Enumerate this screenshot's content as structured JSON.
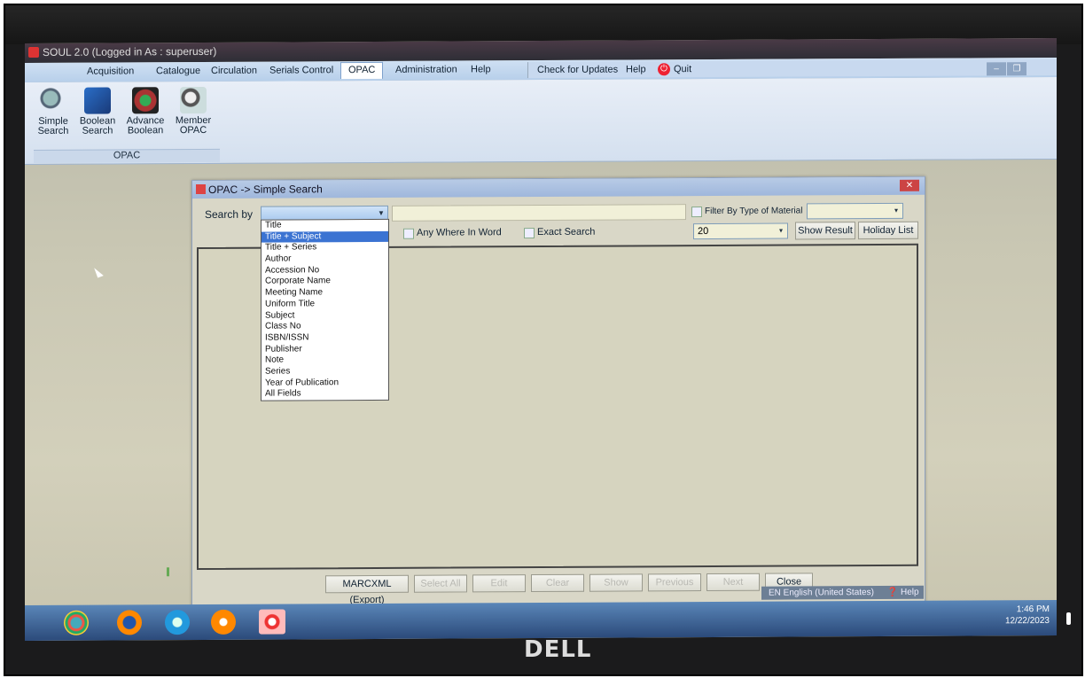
{
  "window": {
    "title": "SOUL 2.0  (Logged in As : superuser)"
  },
  "menu": {
    "items": [
      "Acquisition",
      "Catalogue",
      "Circulation",
      "Serials Control",
      "OPAC",
      "Administration",
      "Help"
    ],
    "right": [
      "Check for Updates",
      "Help",
      "Quit"
    ],
    "active": "OPAC"
  },
  "ribbon": {
    "buttons": [
      {
        "line1": "Simple",
        "line2": "Search",
        "icon": "magnifier-icon"
      },
      {
        "line1": "Boolean",
        "line2": "Search",
        "icon": "boolean-search-icon"
      },
      {
        "line1": "Advance",
        "line2": "Boolean",
        "icon": "advance-boolean-icon"
      },
      {
        "line1": "Member",
        "line2": "OPAC",
        "icon": "member-opac-icon"
      }
    ],
    "group_label": "OPAC"
  },
  "dialog": {
    "title": "OPAC -> Simple Search",
    "search_by_label": "Search by",
    "filter_label": "Filter By Type of Material",
    "any_where_label": "Any Where In Word",
    "exact_label": "Exact Search",
    "results_count": "20",
    "show_result": "Show Result",
    "holiday_list": "Holiday List",
    "dropdown_options": [
      "Title",
      "Title + Subject",
      "Title + Series",
      "Author",
      "Accession No",
      "Corporate Name",
      "Meeting Name",
      "Uniform Title",
      "Subject",
      "Class No",
      "ISBN/ISSN",
      "Publisher",
      "Note",
      "Series",
      "Year of Publication",
      "All Fields"
    ],
    "highlighted_option": "Title + Subject",
    "footer_buttons": [
      "MARCXML (Export)",
      "Select All",
      "Edit",
      "Clear",
      "Show",
      "Previous",
      "Next",
      "Close"
    ]
  },
  "langbar": {
    "text": "EN English (United States)",
    "help": "Help"
  },
  "clock": {
    "time": "1:46 PM",
    "date": "12/22/2023"
  },
  "brand": "DELL"
}
